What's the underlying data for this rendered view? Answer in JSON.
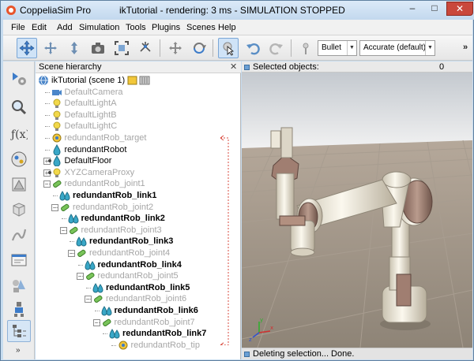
{
  "app": {
    "name": "CoppeliaSim Pro",
    "window_title": "ikTutorial - rendering: 3 ms - SIMULATION STOPPED"
  },
  "window_controls": {
    "minimize": "–",
    "maximize": "□",
    "close": "✕"
  },
  "menu": [
    "File",
    "Edit",
    "Add",
    "Simulation",
    "Tools",
    "Plugins",
    "Scenes",
    "Help"
  ],
  "toolbar": {
    "buttons": [
      {
        "name": "move-camera-icon",
        "active": true
      },
      {
        "name": "rotate-camera-icon"
      },
      {
        "name": "zoom-camera-icon"
      },
      {
        "name": "camera-angle-icon"
      },
      {
        "name": "fit-to-view-icon"
      },
      {
        "name": "assemble-icon"
      },
      {
        "name": "object-shift-icon"
      },
      {
        "name": "object-rotate-icon"
      },
      {
        "name": "click-select-icon",
        "active": true
      },
      {
        "name": "undo-icon"
      },
      {
        "name": "redo-icon"
      },
      {
        "name": "dynamics-settings-icon"
      }
    ],
    "engine_select": "Bullet",
    "accuracy_select": "Accurate (default)",
    "overflow": "»"
  },
  "leftbar": {
    "buttons": [
      "simulation-settings-icon",
      "search-icon",
      "script-icon",
      "collections-icon",
      "shapes-icon",
      "selection-icon",
      "path-icon",
      "ui-editor-icon",
      "shape-edit-icon",
      "model-browser-icon",
      "scene-hierarchy-icon"
    ],
    "overflow": "»"
  },
  "hierarchy": {
    "title": "Scene hierarchy",
    "close": "✕",
    "items": [
      {
        "label": "ikTutorial (scene 1)",
        "icon": "scene",
        "level": 0,
        "grey": false
      },
      {
        "label": "DefaultCamera",
        "icon": "camera",
        "level": 1,
        "grey": true
      },
      {
        "label": "DefaultLightA",
        "icon": "light",
        "level": 1,
        "grey": true
      },
      {
        "label": "DefaultLightB",
        "icon": "light",
        "level": 1,
        "grey": true
      },
      {
        "label": "DefaultLightC",
        "icon": "light",
        "level": 1,
        "grey": true
      },
      {
        "label": "redundantRob_target",
        "icon": "dummy",
        "level": 1,
        "grey": true
      },
      {
        "label": "redundantRobot",
        "icon": "shape",
        "level": 1,
        "grey": false
      },
      {
        "label": "DefaultFloor",
        "icon": "shape",
        "level": 1,
        "grey": false,
        "expander": "+"
      },
      {
        "label": "XYZCameraProxy",
        "icon": "light",
        "level": 1,
        "grey": true,
        "expander": "+"
      },
      {
        "label": "redundantRob_joint1",
        "icon": "joint",
        "level": 1,
        "grey": true,
        "expander": "-"
      },
      {
        "label": "redundantRob_link1",
        "icon": "link",
        "level": 2,
        "grey": false,
        "bold": true
      },
      {
        "label": "redundantRob_joint2",
        "icon": "joint",
        "level": 2,
        "grey": true,
        "expander": "-"
      },
      {
        "label": "redundantRob_link2",
        "icon": "link",
        "level": 3,
        "grey": false,
        "bold": true
      },
      {
        "label": "redundantRob_joint3",
        "icon": "joint",
        "level": 3,
        "grey": true,
        "expander": "-"
      },
      {
        "label": "redundantRob_link3",
        "icon": "link",
        "level": 4,
        "grey": false,
        "bold": true
      },
      {
        "label": "redundantRob_joint4",
        "icon": "joint",
        "level": 4,
        "grey": true,
        "expander": "-"
      },
      {
        "label": "redundantRob_link4",
        "icon": "link",
        "level": 5,
        "grey": false,
        "bold": true
      },
      {
        "label": "redundantRob_joint5",
        "icon": "joint",
        "level": 5,
        "grey": true,
        "expander": "-"
      },
      {
        "label": "redundantRob_link5",
        "icon": "link",
        "level": 6,
        "grey": false,
        "bold": true
      },
      {
        "label": "redundantRob_joint6",
        "icon": "joint",
        "level": 6,
        "grey": true,
        "expander": "-"
      },
      {
        "label": "redundantRob_link6",
        "icon": "link",
        "level": 7,
        "grey": false,
        "bold": true
      },
      {
        "label": "redundantRob_joint7",
        "icon": "joint",
        "level": 7,
        "grey": true,
        "expander": "-"
      },
      {
        "label": "redundantRob_link7",
        "icon": "link",
        "level": 8,
        "grey": false,
        "bold": true
      },
      {
        "label": "redundantRob_tip",
        "icon": "dummy",
        "level": 9,
        "grey": true
      }
    ]
  },
  "viewport": {
    "selected_label": "Selected objects:",
    "selected_count": "0",
    "status_text": "Deleting selection... Done."
  },
  "colors": {
    "accent": "#3d7cc9",
    "link_line": "#d94b3f",
    "chrome": "#c7dcef"
  }
}
